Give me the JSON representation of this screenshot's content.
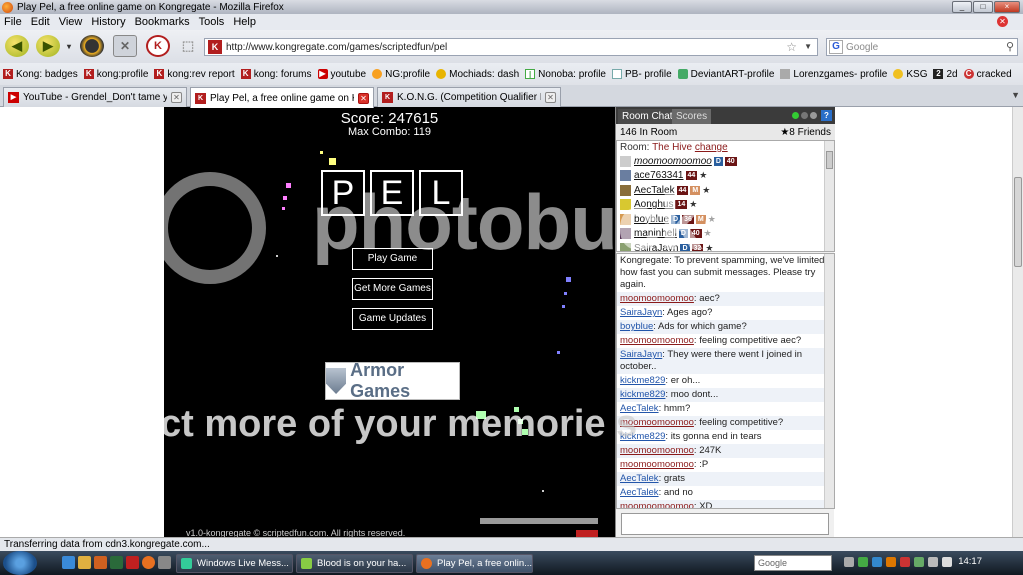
{
  "window": {
    "title": "Play Pel, a free online game on Kongregate - Mozilla Firefox",
    "controls": [
      "_",
      "□",
      "×"
    ]
  },
  "menu": [
    "File",
    "Edit",
    "View",
    "History",
    "Bookmarks",
    "Tools",
    "Help"
  ],
  "nav": {
    "url": "http://www.kongregate.com/games/scriptedfun/pel",
    "search_placeholder": "Google"
  },
  "bookmarks": [
    {
      "label": "Kong: badges",
      "icon": "kong"
    },
    {
      "label": "kong:profile",
      "icon": "kong"
    },
    {
      "label": "kong:rev report",
      "icon": "kong"
    },
    {
      "label": "kong: forums",
      "icon": "kong"
    },
    {
      "label": "youtube",
      "icon": "yt"
    },
    {
      "label": "NG:profile",
      "icon": "ng"
    },
    {
      "label": "Mochiads: dash",
      "icon": "moc"
    },
    {
      "label": "Nonoba: profile",
      "icon": "nono"
    },
    {
      "label": "PB- profile",
      "icon": "pb"
    },
    {
      "label": "DeviantART-profile",
      "icon": "da"
    },
    {
      "label": "Lorenzgames- profile",
      "icon": "lor"
    },
    {
      "label": "KSG",
      "icon": "ksg"
    },
    {
      "label": "2d",
      "icon": "b2d"
    },
    {
      "label": "cracked",
      "icon": "cr"
    }
  ],
  "tabs": [
    {
      "label": "YouTube - Grendel_Don't tame you...",
      "active": false
    },
    {
      "label": "Play Pel, a free online game on Ko...",
      "active": true
    },
    {
      "label": "K.O.N.G. (Competition Qualifier Ro...",
      "active": false
    }
  ],
  "game": {
    "score": "Score: 247615",
    "max_combo": "Max Combo: 119",
    "title_letters": [
      "P",
      "E",
      "L"
    ],
    "buttons": [
      "Play Game",
      "Get More Games",
      "Game Updates"
    ],
    "sponsor": "Armor Games",
    "credit": "v1.0-kongregate © scriptedfun.com. All rights reserved."
  },
  "chat": {
    "tab_room": "Room Chat",
    "tab_scores": "Scores",
    "in_room": "146 In Room",
    "friends": "★8 Friends",
    "room_label": "Room:",
    "room_name": "The Hive",
    "room_change": "change",
    "users": [
      {
        "name": "moomoomoomoo",
        "badges": [
          "D",
          "40"
        ],
        "star": false
      },
      {
        "name": "ace763341",
        "badges": [
          "44"
        ],
        "star": true
      },
      {
        "name": "AecTalek",
        "badges": [
          "44",
          "M"
        ],
        "star": true
      },
      {
        "name": "Aonghus",
        "badges": [
          "14"
        ],
        "star": true
      },
      {
        "name": "boyblue",
        "badges": [
          "D",
          "36",
          "M"
        ],
        "star": true
      },
      {
        "name": "maninhell",
        "badges": [
          "D",
          "40"
        ],
        "star": true
      },
      {
        "name": "SairaJayn",
        "badges": [
          "D",
          "32"
        ],
        "star": true
      }
    ],
    "messages": [
      {
        "who": "",
        "text": "we've limited how fast you can submit messages. Please try again.",
        "pre": "Kongregate: To prevent spamming,"
      },
      {
        "who": "moomoomoomoo",
        "text": ": aec?"
      },
      {
        "who": "SairaJayn",
        "text": ": Ages ago?"
      },
      {
        "who": "boyblue",
        "text": ": Ads for which game?"
      },
      {
        "who": "moomoomoomoo",
        "text": ": feeling competitive aec?"
      },
      {
        "who": "SairaJayn",
        "text": ": They were there went I joined in october.."
      },
      {
        "who": "kickme829",
        "text": ": er oh..."
      },
      {
        "who": "kickme829",
        "text": ": moo dont..."
      },
      {
        "who": "AecTalek",
        "text": ": hmm?"
      },
      {
        "who": "moomoomoomoo",
        "text": ": feeling competitive?"
      },
      {
        "who": "kickme829",
        "text": ": its gonna end in tears"
      },
      {
        "who": "moomoomoomoo",
        "text": ": 247K"
      },
      {
        "who": "moomoomoomoo",
        "text": ": :P"
      },
      {
        "who": "AecTalek",
        "text": ": grats"
      },
      {
        "who": "AecTalek",
        "text": ": and no"
      },
      {
        "who": "moomoomoomoo",
        "text": ": XD"
      }
    ]
  },
  "watermark": {
    "logo": "photobucket",
    "cta_left": "ct more of your memorie",
    "cta_right": "s"
  },
  "status": "Transferring data from cdn3.kongregate.com...",
  "taskbar": {
    "items": [
      {
        "label": "Windows Live Mess...",
        "active": false
      },
      {
        "label": "Blood is on your ha...",
        "active": false
      },
      {
        "label": "Play Pel, a free onlin...",
        "active": true
      }
    ],
    "search_placeholder": "Google",
    "clock": "14:17"
  }
}
